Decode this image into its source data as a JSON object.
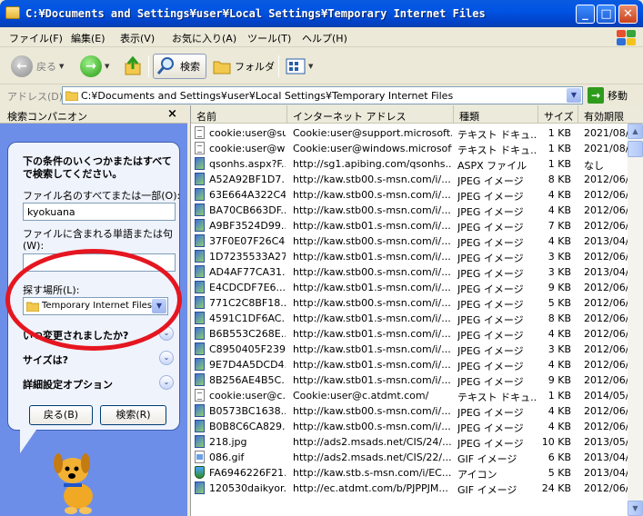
{
  "window": {
    "title": "C:¥Documents and Settings¥user¥Local Settings¥Temporary Internet Files",
    "minimize_glyph": "_",
    "maximize_glyph": "□",
    "close_glyph": "✕"
  },
  "menu": [
    "ファイル(F)",
    "編集(E)",
    "表示(V)",
    "お気に入り(A)",
    "ツール(T)",
    "ヘルプ(H)"
  ],
  "toolbar": {
    "back_label": "戻る",
    "search_label": "検索",
    "folders_label": "フォルダ"
  },
  "address": {
    "label": "アドレス(D)",
    "value": "C:¥Documents and Settings¥user¥Local Settings¥Temporary Internet Files",
    "go_label": "移動"
  },
  "companion": {
    "title": "検索コンパニオン",
    "close_glyph": "×",
    "instructions": "下の条件のいくつかまたはすべてで検索してください。",
    "filename_label": "ファイル名のすべてまたは一部(O):",
    "filename_value": "kyokuana",
    "word_label": "ファイルに含まれる単語または句(W):",
    "word_value": "",
    "location_label": "探す場所(L):",
    "location_value": "Temporary Internet Files",
    "when_modified": "いつ変更されましたか?",
    "size_label": "サイズは?",
    "advanced_label": "詳細設定オプション",
    "back_button": "戻る(B)",
    "search_button": "検索(R)"
  },
  "list": {
    "columns": [
      "名前",
      "インターネット アドレス",
      "種類",
      "サイズ",
      "有効期限"
    ],
    "rows": [
      {
        "icon": "text",
        "name": "cookie:user@su...",
        "address": "Cookie:user@support.microsoft....",
        "type": "テキスト ドキュ...",
        "size": "1 KB",
        "expires": "2021/08/"
      },
      {
        "icon": "text",
        "name": "cookie:user@wi...",
        "address": "Cookie:user@windows.microsoft...",
        "type": "テキスト ドキュ...",
        "size": "1 KB",
        "expires": "2021/08/"
      },
      {
        "icon": "web",
        "name": "qsonhs.aspx?F...",
        "address": "http://sg1.apibing.com/qsonhs...",
        "type": "ASPX ファイル",
        "size": "1 KB",
        "expires": "なし"
      },
      {
        "icon": "jpeg",
        "name": "A52A92BF1D7...",
        "address": "http://kaw.stb00.s-msn.com/i/...",
        "type": "JPEG イメージ",
        "size": "8 KB",
        "expires": "2012/06/"
      },
      {
        "icon": "jpeg",
        "name": "63E664A322C4...",
        "address": "http://kaw.stb00.s-msn.com/i/...",
        "type": "JPEG イメージ",
        "size": "4 KB",
        "expires": "2012/06/"
      },
      {
        "icon": "jpeg",
        "name": "BA70CB663DF...",
        "address": "http://kaw.stb00.s-msn.com/i/...",
        "type": "JPEG イメージ",
        "size": "4 KB",
        "expires": "2012/06/"
      },
      {
        "icon": "jpeg",
        "name": "A9BF3524D99...",
        "address": "http://kaw.stb01.s-msn.com/i/...",
        "type": "JPEG イメージ",
        "size": "7 KB",
        "expires": "2012/06/"
      },
      {
        "icon": "jpeg",
        "name": "37F0E07F26C4...",
        "address": "http://kaw.stb00.s-msn.com/i/...",
        "type": "JPEG イメージ",
        "size": "4 KB",
        "expires": "2013/04/"
      },
      {
        "icon": "jpeg",
        "name": "1D7235533A27...",
        "address": "http://kaw.stb01.s-msn.com/i/...",
        "type": "JPEG イメージ",
        "size": "3 KB",
        "expires": "2012/06/"
      },
      {
        "icon": "jpeg",
        "name": "AD4AF77CA31...",
        "address": "http://kaw.stb00.s-msn.com/i/...",
        "type": "JPEG イメージ",
        "size": "3 KB",
        "expires": "2013/04/"
      },
      {
        "icon": "jpeg",
        "name": "E4CDCDF7E6...",
        "address": "http://kaw.stb01.s-msn.com/i/...",
        "type": "JPEG イメージ",
        "size": "9 KB",
        "expires": "2012/06/"
      },
      {
        "icon": "jpeg",
        "name": "771C2C8BF18...",
        "address": "http://kaw.stb00.s-msn.com/i/...",
        "type": "JPEG イメージ",
        "size": "5 KB",
        "expires": "2012/06/"
      },
      {
        "icon": "jpeg",
        "name": "4591C1DF6AC...",
        "address": "http://kaw.stb01.s-msn.com/i/...",
        "type": "JPEG イメージ",
        "size": "8 KB",
        "expires": "2012/06/"
      },
      {
        "icon": "jpeg",
        "name": "B6B553C268E...",
        "address": "http://kaw.stb01.s-msn.com/i/...",
        "type": "JPEG イメージ",
        "size": "4 KB",
        "expires": "2012/06/"
      },
      {
        "icon": "jpeg",
        "name": "C8950405F239...",
        "address": "http://kaw.stb01.s-msn.com/i/...",
        "type": "JPEG イメージ",
        "size": "3 KB",
        "expires": "2012/06/"
      },
      {
        "icon": "jpeg",
        "name": "9E7D4A5DCD4...",
        "address": "http://kaw.stb01.s-msn.com/i/...",
        "type": "JPEG イメージ",
        "size": "4 KB",
        "expires": "2012/06/"
      },
      {
        "icon": "jpeg",
        "name": "8B256AE4B5C...",
        "address": "http://kaw.stb01.s-msn.com/i/...",
        "type": "JPEG イメージ",
        "size": "9 KB",
        "expires": "2012/06/"
      },
      {
        "icon": "text",
        "name": "cookie:user@c...",
        "address": "Cookie:user@c.atdmt.com/",
        "type": "テキスト ドキュ...",
        "size": "1 KB",
        "expires": "2014/05/"
      },
      {
        "icon": "jpeg",
        "name": "B0573BC1638...",
        "address": "http://kaw.stb00.s-msn.com/i/...",
        "type": "JPEG イメージ",
        "size": "4 KB",
        "expires": "2012/06/"
      },
      {
        "icon": "jpeg",
        "name": "B0B8C6CA829...",
        "address": "http://kaw.stb00.s-msn.com/i/...",
        "type": "JPEG イメージ",
        "size": "4 KB",
        "expires": "2012/06/"
      },
      {
        "icon": "jpeg",
        "name": "218.jpg",
        "address": "http://ads2.msads.net/CIS/24/...",
        "type": "JPEG イメージ",
        "size": "10 KB",
        "expires": "2013/05/"
      },
      {
        "icon": "image",
        "name": "086.gif",
        "address": "http://ads2.msads.net/CIS/22/...",
        "type": "GIF イメージ",
        "size": "6 KB",
        "expires": "2013/04/"
      },
      {
        "icon": "mascot",
        "name": "FA6946226F21...",
        "address": "http://kaw.stb.s-msn.com/i/EC...",
        "type": "アイコン",
        "size": "5 KB",
        "expires": "2013/04/"
      },
      {
        "icon": "gif",
        "name": "120530daikyor...",
        "address": "http://ec.atdmt.com/b/PJPPJM...",
        "type": "GIF イメージ",
        "size": "24 KB",
        "expires": "2012/06/"
      }
    ]
  },
  "colors": {
    "titlebar": "#0054e3",
    "companion_bg": "#6d8ee8",
    "highlight_oval": "#e51620"
  }
}
